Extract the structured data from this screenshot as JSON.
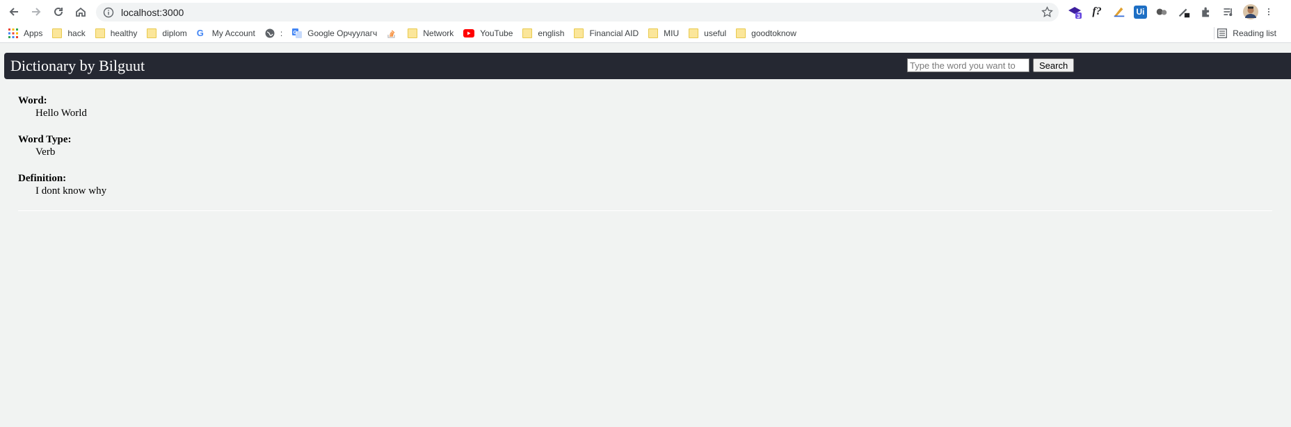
{
  "browser": {
    "url": "localhost:3000",
    "bookmarks": [
      {
        "label": "Apps",
        "icon": "apps-grid-icon"
      },
      {
        "label": "hack",
        "icon": "folder-icon"
      },
      {
        "label": "healthy",
        "icon": "folder-icon"
      },
      {
        "label": "diplom",
        "icon": "folder-icon"
      },
      {
        "label": "My Account",
        "icon": "google-icon"
      },
      {
        "label": ":",
        "icon": "globe-icon"
      },
      {
        "label": "Google Орчуулагч",
        "icon": "google-translate-icon"
      },
      {
        "label": "",
        "icon": "stackoverflow-icon"
      },
      {
        "label": "Network",
        "icon": "folder-icon"
      },
      {
        "label": "YouTube",
        "icon": "youtube-icon"
      },
      {
        "label": "english",
        "icon": "folder-icon"
      },
      {
        "label": "Financial AID",
        "icon": "folder-icon"
      },
      {
        "label": "MIU",
        "icon": "folder-icon"
      },
      {
        "label": "useful",
        "icon": "folder-icon"
      },
      {
        "label": "goodtoknow",
        "icon": "folder-icon"
      }
    ],
    "reading_list": "Reading list",
    "extensions": [
      {
        "name": "graduation-cap-extension-icon",
        "badge": "3"
      },
      {
        "name": "formula-extension-icon",
        "text": "f?"
      },
      {
        "name": "ruler-extension-icon"
      },
      {
        "name": "uipath-extension-icon",
        "text": "Ui"
      },
      {
        "name": "glasses-extension-icon"
      },
      {
        "name": "eyedropper-extension-icon"
      },
      {
        "name": "puzzle-extensions-icon"
      },
      {
        "name": "media-control-icon"
      },
      {
        "name": "profile-avatar-icon"
      },
      {
        "name": "kebab-menu-icon"
      }
    ]
  },
  "app": {
    "title": "Dictionary by Bilguut",
    "search": {
      "placeholder": "Type the word you want to",
      "button_label": "Search"
    }
  },
  "entry": {
    "word_label": "Word:",
    "word": "Hello World",
    "type_label": "Word Type:",
    "type": "Verb",
    "definition_label": "Definition:",
    "definition": "I dont know why"
  },
  "colors": {
    "header_bg": "#252832",
    "page_bg": "#f1f3f2"
  }
}
